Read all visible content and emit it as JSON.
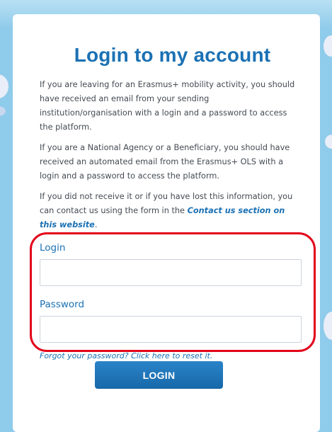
{
  "page": {
    "title": "Login to my account",
    "paragraphs": [
      "If you are leaving for an Erasmus+ mobility activity, you should have received an email from your sending institution/organisation with a login and a password to access the platform.",
      "If you are a National Agency or a Beneficiary, you should have received an automated email from the Erasmus+ OLS with a login and a password to access the platform."
    ],
    "contact_text_before": "If you did not receive it or if you have lost this information, you can contact us using the form in the ",
    "contact_link": "Contact us section on this website",
    "contact_text_after": "."
  },
  "form": {
    "login_label": "Login",
    "login_value": "",
    "password_label": "Password",
    "password_value": "",
    "forgot_link": "Forgot your password? Click here to reset it.",
    "submit_label": "LOGIN"
  },
  "colors": {
    "brand_blue": "#1b71b4",
    "highlight_red": "#e3031b",
    "background": "#8fcbea"
  }
}
